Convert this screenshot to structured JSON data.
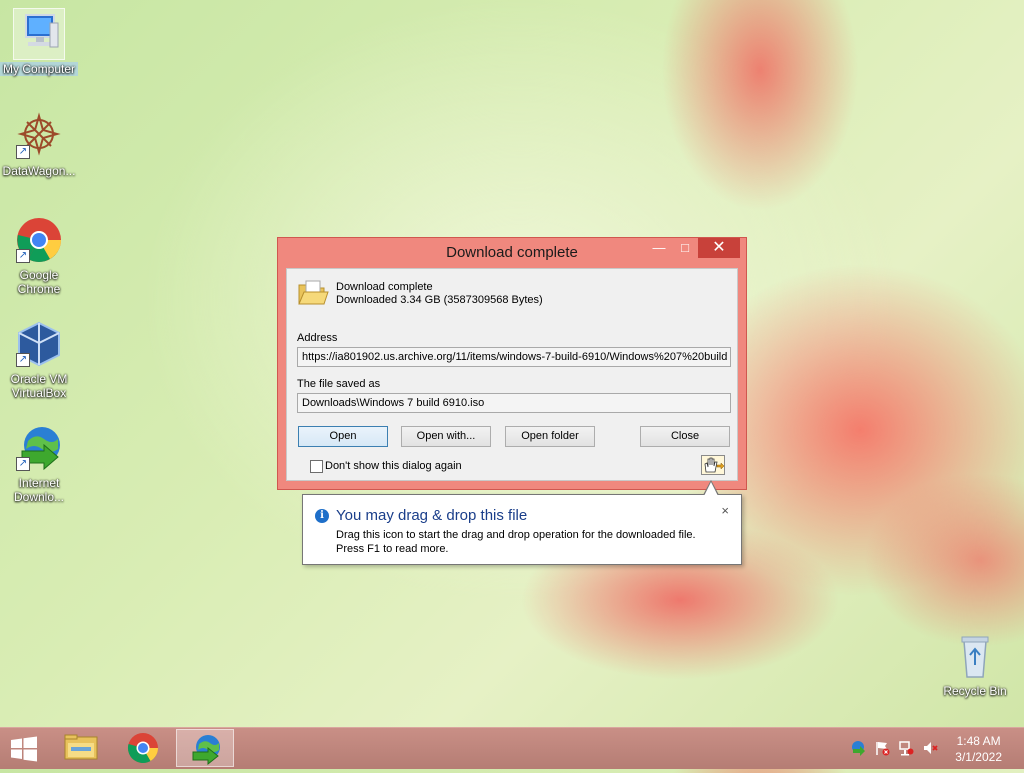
{
  "desktop": {
    "icons": [
      {
        "label": "My Computer",
        "icon": "computer-icon"
      },
      {
        "label": "DataWagon...",
        "icon": "datawagon-icon"
      },
      {
        "label": "Google Chrome",
        "icon": "chrome-icon"
      },
      {
        "label": "Oracle VM VirtualBox",
        "icon": "virtualbox-icon"
      },
      {
        "label": "Internet Downlo...",
        "icon": "idm-icon"
      },
      {
        "label": "Recycle Bin",
        "icon": "recycle-bin-icon"
      }
    ]
  },
  "dialog": {
    "title": "Download complete",
    "status_title": "Download complete",
    "status_size": "Downloaded 3.34  GB (3587309568 Bytes)",
    "address_label": "Address",
    "address_value": "https://ia801902.us.archive.org/11/items/windows-7-build-6910/Windows%207%20build",
    "saved_label": "The file saved as",
    "saved_value": "Downloads\\Windows 7 build 6910.iso",
    "buttons": {
      "open": "Open",
      "open_with": "Open with...",
      "open_folder": "Open folder",
      "close": "Close"
    },
    "checkbox_label": "Don't show this dialog again",
    "controls": {
      "minimize": "—",
      "maximize": "□",
      "close": "✕"
    }
  },
  "balloon": {
    "title": "You may drag & drop this file",
    "line1": "Drag this icon to start the drag and drop operation for the downloaded file.",
    "line2": "Press F1 to read more.",
    "close": "×"
  },
  "taskbar": {
    "time": "1:48 AM",
    "date": "3/1/2022"
  },
  "colors": {
    "titlebar": "#f0887e",
    "close_button": "#c8413a",
    "taskbar": "#c98f86",
    "balloon_title": "#1a3e8a"
  }
}
